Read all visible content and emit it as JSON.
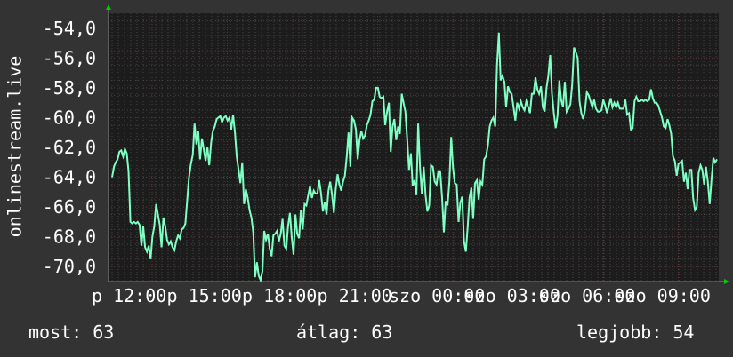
{
  "chart_data": {
    "type": "line",
    "ylabel": "onlinestream.live",
    "ylim": [
      -71,
      -53
    ],
    "y_ticks": [
      "-54,0",
      "-56,0",
      "-58,0",
      "-60,0",
      "-62,0",
      "-64,0",
      "-66,0",
      "-68,0",
      "-70,0"
    ],
    "x_ticks": [
      "p 12:00",
      "p 15:00",
      "p 18:00",
      "p 21:00",
      "szo 00:00",
      "szo 03:00",
      "szo 06:00",
      "szo 09:00"
    ],
    "grid": true,
    "colors": {
      "line": "#7fffc4",
      "background": "#333333",
      "plot_bg": "#1c1c1c",
      "grid_minor": "#444444",
      "grid_major": "#5a3a3a",
      "axis": "#888888",
      "arrow": "#00cc00"
    },
    "series": [
      {
        "values": [
          -64,
          -63.3,
          -63,
          -62.8,
          -62.3,
          -62.2,
          -62.6,
          -62.1,
          -62.4,
          -63.6,
          -67,
          -67.1,
          -67,
          -67.1,
          -67,
          -67.2,
          -68.6,
          -67.3,
          -68.7,
          -69,
          -68.6,
          -69.5,
          -68,
          -67.3,
          -65.8,
          -66.5,
          -67.2,
          -68.7,
          -66.7,
          -67.3,
          -68.2,
          -68.5,
          -68.3,
          -68.7,
          -68.9,
          -68.3,
          -67.9,
          -68.1,
          -67.5,
          -67.4,
          -67.1,
          -65.5,
          -64,
          -63.1,
          -62.5,
          -60.4,
          -61.8,
          -60.9,
          -62.8,
          -61.4,
          -62.1,
          -62.9,
          -62,
          -63.2,
          -61.7,
          -60.9,
          -60.6,
          -60.1,
          -60,
          -59.9,
          -60.3,
          -60,
          -59.9,
          -60.2,
          -60,
          -60.8,
          -59.8,
          -61,
          -62.6,
          -63.5,
          -64.4,
          -63,
          -65.8,
          -64.8,
          -65.4,
          -66.2,
          -66.7,
          -67.7,
          -70.7,
          -69.7,
          -70.6,
          -70.9,
          -70.3,
          -67.6,
          -68.2,
          -67.8,
          -68.8,
          -69.3,
          -67.9,
          -67.8,
          -67.6,
          -68.3,
          -67.8,
          -66.8,
          -68.6,
          -68.8,
          -67.3,
          -66.4,
          -68,
          -69.2,
          -66.5,
          -67.8,
          -68.1,
          -66.2,
          -67.5,
          -65.8,
          -65.9,
          -65.2,
          -64.6,
          -65.4,
          -64.9,
          -65.1,
          -65.1,
          -64.2,
          -65.1,
          -66.3,
          -65.7,
          -66.5,
          -64.9,
          -64.3,
          -65.2,
          -66.4,
          -64.8,
          -63.8,
          -64.5,
          -64.9,
          -64.3,
          -63.9,
          -62.6,
          -61,
          -63.3,
          -60,
          -60.2,
          -60.8,
          -62.8,
          -61.5,
          -60.9,
          -61.4,
          -61.2,
          -60.5,
          -60.2,
          -59.8,
          -58.9,
          -58.8,
          -58,
          -58,
          -58.6,
          -58.7,
          -58.6,
          -60.5,
          -59.6,
          -59,
          -62.3,
          -60.6,
          -60.1,
          -61.5,
          -60.6,
          -61.1,
          -58.4,
          -59,
          -59.6,
          -61.5,
          -63.5,
          -62.4,
          -64.6,
          -64.2,
          -65.2,
          -60.4,
          -63.4,
          -65.1,
          -63.3,
          -65.2,
          -66.3,
          -65.9,
          -63.2,
          -63.3,
          -64.3,
          -64.5,
          -63.6,
          -63.6,
          -65.3,
          -67.7,
          -65.6,
          -65.9,
          -64.3,
          -61.3,
          -63.4,
          -64.4,
          -64.5,
          -67,
          -65.7,
          -65.3,
          -68.3,
          -69,
          -67.3,
          -65.4,
          -64.7,
          -66.8,
          -64.4,
          -64.2,
          -65.5,
          -64.3,
          -64.5,
          -62.8,
          -62.6,
          -61.9,
          -60.6,
          -60.2,
          -60,
          -60.6,
          -56.5,
          -54.3,
          -57.5,
          -57.2,
          -57.6,
          -59.3,
          -57.9,
          -58.3,
          -58.4,
          -59.3,
          -60.2,
          -59,
          -59.4,
          -58.9,
          -59.3,
          -59.5,
          -58.9,
          -59.3,
          -59.7,
          -58.4,
          -58.4,
          -57.3,
          -58.1,
          -58.4,
          -57.9,
          -59.3,
          -59.6,
          -58,
          -57.2,
          -55.8,
          -58.4,
          -59.7,
          -60.7,
          -59.9,
          -57.5,
          -58.8,
          -59.3,
          -57.6,
          -59.6,
          -59.4,
          -59.1,
          -57.8,
          -55.3,
          -55.6,
          -56,
          -58.9,
          -59.7,
          -60.1,
          -59.5,
          -58.3,
          -58.5,
          -58.9,
          -59.3,
          -58.8,
          -59.4,
          -59.6,
          -59.6,
          -59.5,
          -58.8,
          -59.2,
          -59.7,
          -59.2,
          -58.7,
          -59.3,
          -59,
          -59.3,
          -59,
          -59.4,
          -59.4,
          -59.4,
          -58.8,
          -59.8,
          -59.7,
          -60.8,
          -60.7,
          -58.9,
          -58.6,
          -58.9,
          -58.9,
          -58.8,
          -58.9,
          -58.8,
          -58.9,
          -58.8,
          -58.1,
          -58.7,
          -59,
          -59,
          -59.2,
          -59.6,
          -60,
          -60.6,
          -60.7,
          -60.1,
          -60.5,
          -61.1,
          -62.6,
          -62.9,
          -63.9,
          -63.1,
          -63,
          -62.9,
          -64.3,
          -63.7,
          -64.8,
          -63.5,
          -63.5,
          -65.4,
          -66.2,
          -66,
          -63.7,
          -63.2,
          -63.5,
          -64.5,
          -63.3,
          -64.3,
          -65.8,
          -64.2,
          -62.7,
          -63,
          -62.8
        ]
      }
    ]
  },
  "footer": {
    "current": "most: 63",
    "average": "átlag: 63",
    "best": "legjobb: 54"
  }
}
